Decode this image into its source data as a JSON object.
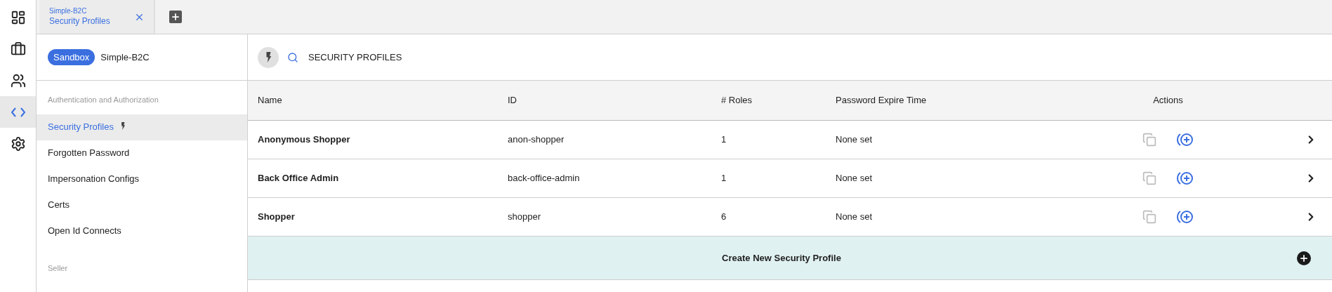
{
  "rail": [
    {
      "kind": "dashboard",
      "selected": false
    },
    {
      "kind": "briefcase",
      "selected": false
    },
    {
      "kind": "people",
      "selected": false
    },
    {
      "kind": "code",
      "selected": true
    },
    {
      "kind": "settings",
      "selected": false
    }
  ],
  "tabs": [
    {
      "subtitle": "Simple-B2C",
      "title": "Security Profiles",
      "selected": true
    }
  ],
  "sidebar": {
    "badge": "Sandbox",
    "name": "Simple-B2C",
    "sections": [
      {
        "heading": "Authentication and Authorization",
        "items": [
          {
            "label": "Security Profiles",
            "selected": true,
            "flash": true
          },
          {
            "label": "Forgotten Password",
            "selected": false,
            "flash": false
          },
          {
            "label": "Impersonation Configs",
            "selected": false,
            "flash": false
          },
          {
            "label": "Certs",
            "selected": false,
            "flash": false
          },
          {
            "label": "Open Id Connects",
            "selected": false,
            "flash": false
          }
        ]
      },
      {
        "heading": "Seller"
      }
    ]
  },
  "header": {
    "title": "SECURITY PROFILES"
  },
  "table": {
    "columns": [
      "Name",
      "ID",
      "# Roles",
      "Password Expire Time",
      "Actions"
    ],
    "rows": [
      {
        "name": "Anonymous Shopper",
        "id": "anon-shopper",
        "roles": "1",
        "expire": "None set"
      },
      {
        "name": "Back Office Admin",
        "id": "back-office-admin",
        "roles": "1",
        "expire": "None set"
      },
      {
        "name": "Shopper",
        "id": "shopper",
        "roles": "6",
        "expire": "None set"
      }
    ],
    "create_label": "Create New Security Profile"
  }
}
